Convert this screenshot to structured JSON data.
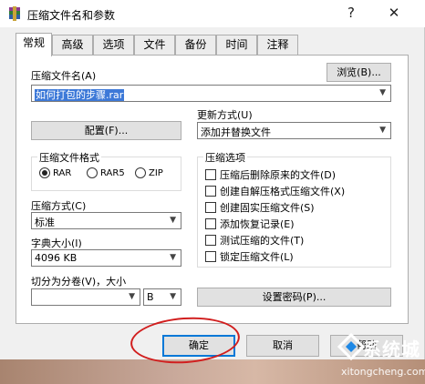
{
  "window": {
    "title": "压缩文件名和参数",
    "help_symbol": "?",
    "close_symbol": "✕"
  },
  "tabs": [
    {
      "label": "常规"
    },
    {
      "label": "高级"
    },
    {
      "label": "选项"
    },
    {
      "label": "文件"
    },
    {
      "label": "备份"
    },
    {
      "label": "时间"
    },
    {
      "label": "注释"
    }
  ],
  "general": {
    "archive_name_label": "压缩文件名(A)",
    "browse_label": "浏览(B)...",
    "archive_name_value": "如何打包的步骤.rar",
    "profiles_label": "配置(F)...",
    "update_mode_label": "更新方式(U)",
    "update_mode_value": "添加并替换文件",
    "format_group_title": "压缩文件格式",
    "formats": [
      {
        "label": "RAR",
        "selected": true
      },
      {
        "label": "RAR5",
        "selected": false
      },
      {
        "label": "ZIP",
        "selected": false
      }
    ],
    "method_label": "压缩方式(C)",
    "method_value": "标准",
    "dict_label": "字典大小(I)",
    "dict_value": "4096 KB",
    "split_label": "切分为分卷(V)，大小",
    "split_value": "",
    "split_unit": "B",
    "options_group_title": "压缩选项",
    "options": [
      {
        "label": "压缩后删除原来的文件(D)",
        "checked": false
      },
      {
        "label": "创建自解压格式压缩文件(X)",
        "checked": false
      },
      {
        "label": "创建固实压缩文件(S)",
        "checked": false
      },
      {
        "label": "添加恢复记录(E)",
        "checked": false
      },
      {
        "label": "测试压缩的文件(T)",
        "checked": false
      },
      {
        "label": "锁定压缩文件(L)",
        "checked": false
      }
    ],
    "password_label": "设置密码(P)..."
  },
  "buttons": {
    "ok": "确定",
    "cancel": "取消",
    "help": "帮助"
  },
  "watermark": {
    "brand": "系统城",
    "url": "xitongcheng.com"
  },
  "colors": {
    "selection": "#3d79d8",
    "annotation_circle": "#d11e1e",
    "default_button_border": "#0078d7"
  }
}
